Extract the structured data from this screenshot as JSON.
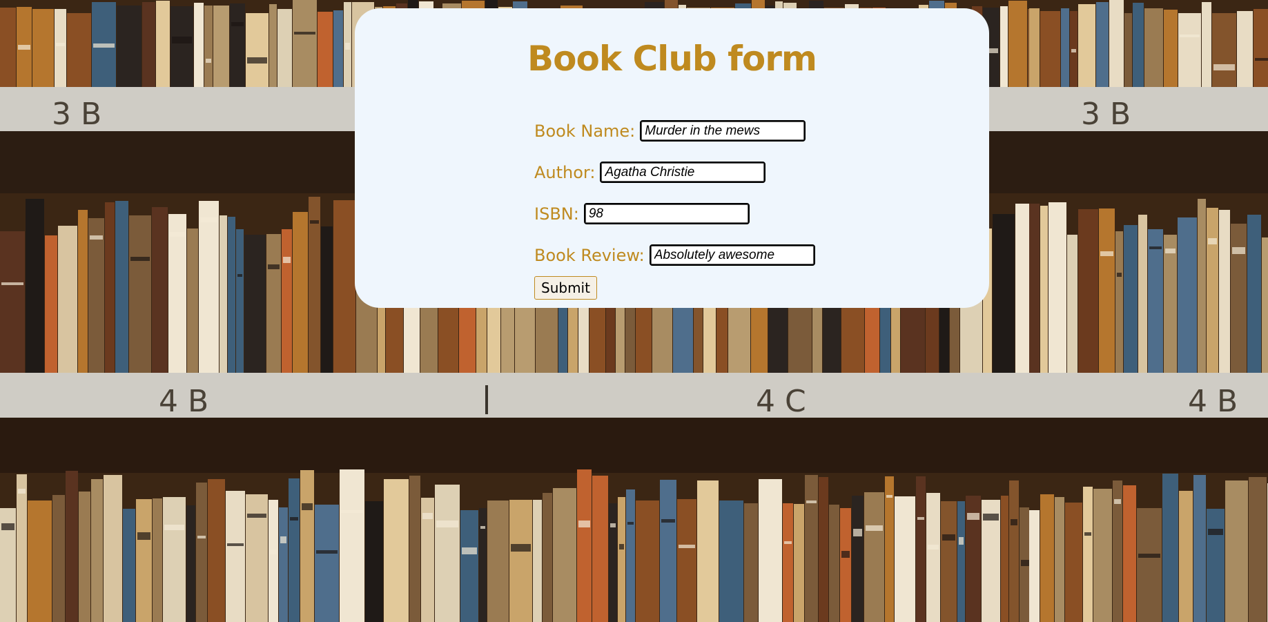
{
  "form": {
    "title": "Book Club form",
    "fields": [
      {
        "label": "Book Name:",
        "value": "Murder in the mews"
      },
      {
        "label": "Author:",
        "value": "Agatha Christie"
      },
      {
        "label": "ISBN:",
        "value": "98"
      },
      {
        "label": "Book Review:",
        "value": "Absolutely awesome"
      }
    ],
    "submit_label": "Submit"
  },
  "background": {
    "shelf_labels": [
      "3 B",
      "4 B",
      "4 C"
    ]
  },
  "colors": {
    "accent": "#bf8a1f",
    "card_background": "#eff6fd",
    "field_border": "#000000"
  }
}
